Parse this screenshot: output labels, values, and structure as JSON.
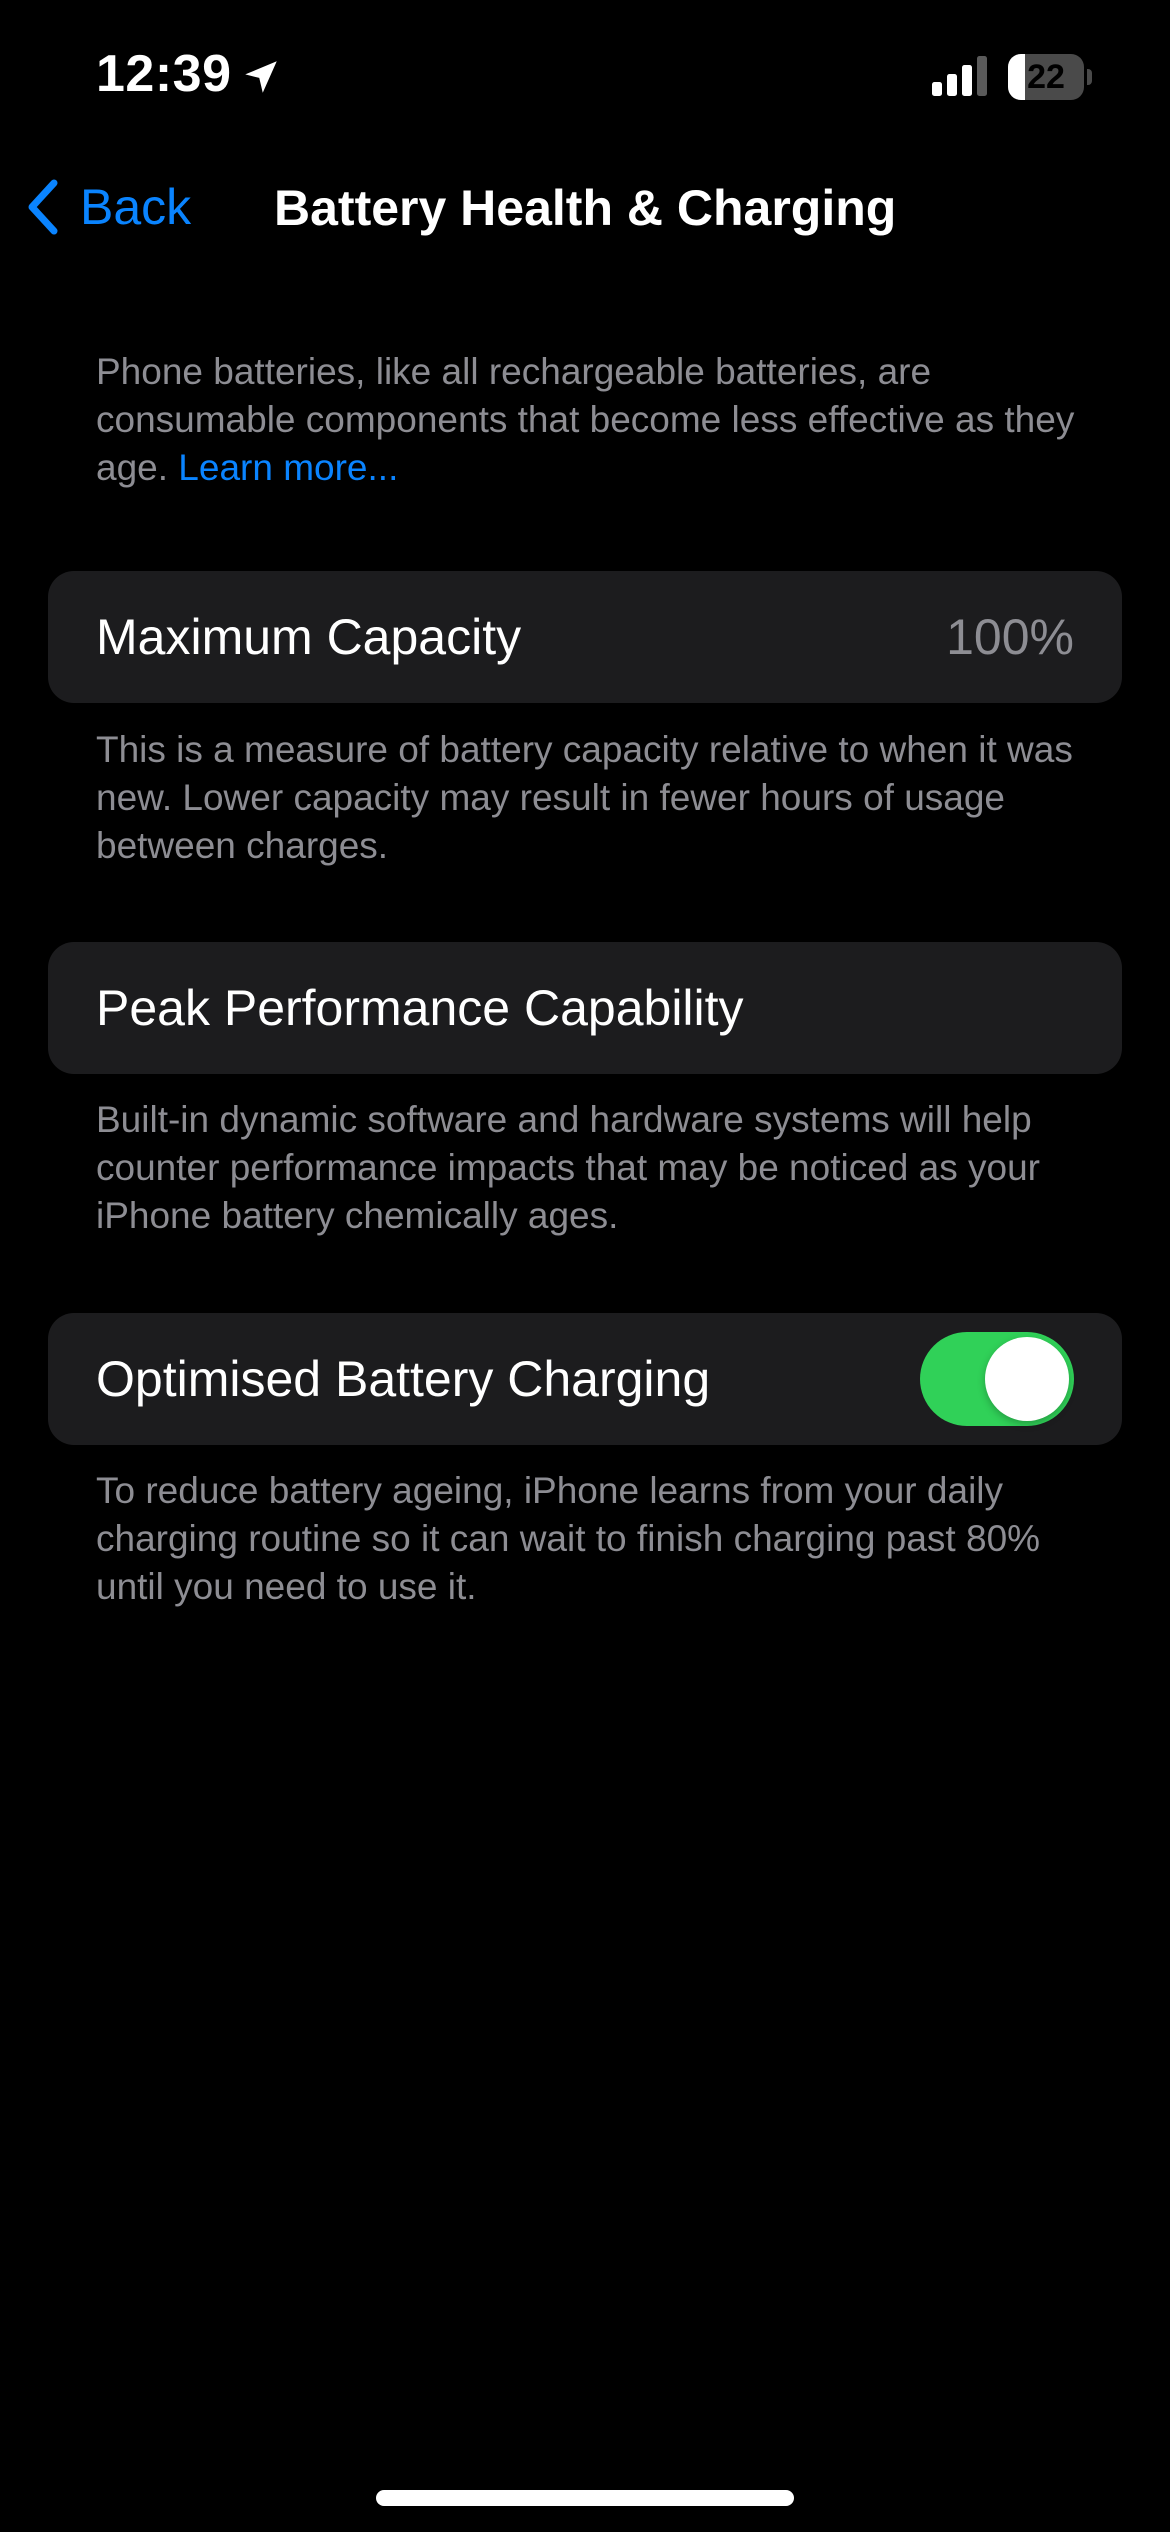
{
  "status_bar": {
    "time": "12:39",
    "battery_level": "22",
    "battery_fraction": 0.22,
    "icons": [
      "location-arrow-icon",
      "cellular-signal-icon",
      "battery-icon"
    ]
  },
  "nav": {
    "back_label": "Back",
    "title": "Battery Health & Charging"
  },
  "intro": {
    "text": "Phone batteries, like all rechargeable batteries, are consumable components that become less effective as they age.",
    "link": "Learn more..."
  },
  "max_capacity": {
    "label": "Maximum Capacity",
    "value": "100%",
    "description": "This is a measure of battery capacity relative to when it was new. Lower capacity may result in fewer hours of usage between charges."
  },
  "peak_performance": {
    "label": "Peak Performance Capability",
    "description": "Built-in dynamic software and hardware systems will help counter performance impacts that may be noticed as your iPhone battery chemically ages."
  },
  "optimised_charging": {
    "label": "Optimised Battery Charging",
    "enabled": true,
    "description": "To reduce battery ageing, iPhone learns from your daily charging routine so it can wait to finish charging past 80% until you need to use it."
  },
  "colors": {
    "background": "#000000",
    "cell": "#1c1c1e",
    "accent": "#0a84ff",
    "toggle_on": "#30d158",
    "secondary_text": "#8d8d93"
  }
}
